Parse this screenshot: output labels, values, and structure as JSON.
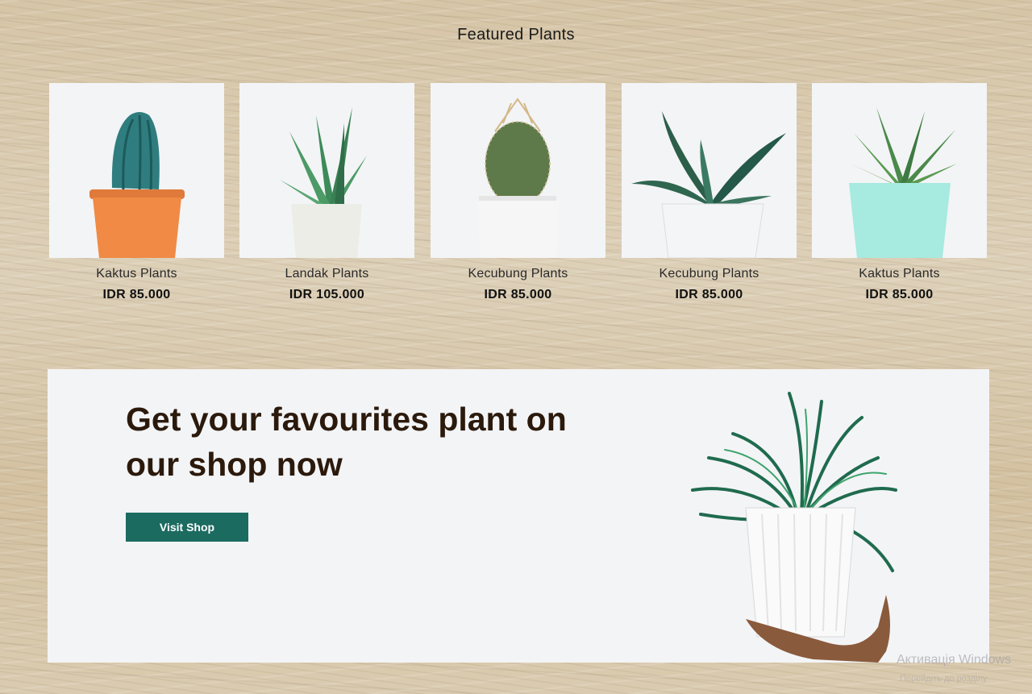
{
  "featured": {
    "title": "Featured Plants",
    "products": [
      {
        "name": "Kaktus Plants",
        "price": "IDR 85.000",
        "image": "cactus-terracotta-pot"
      },
      {
        "name": "Landak Plants",
        "price": "IDR 105.000",
        "image": "aloe-white-pot"
      },
      {
        "name": "Kecubung Plants",
        "price": "IDR 85.000",
        "image": "round-cactus-white-pot"
      },
      {
        "name": "Kecubung Plants",
        "price": "IDR 85.000",
        "image": "gasteria-white-pot"
      },
      {
        "name": "Kaktus Plants",
        "price": "IDR 85.000",
        "image": "haworthia-mint-pot"
      }
    ]
  },
  "promo": {
    "heading": "Get your favourites plant on our shop now",
    "button_label": "Visit Shop",
    "image": "spider-plant-held-in-hand"
  },
  "watermark": {
    "line1": "Активація Windows",
    "line2": "Перейдіть до розділу"
  },
  "colors": {
    "accent": "#1b6b60",
    "card_bg": "#f3f4f6",
    "heading": "#2b1a0c"
  }
}
